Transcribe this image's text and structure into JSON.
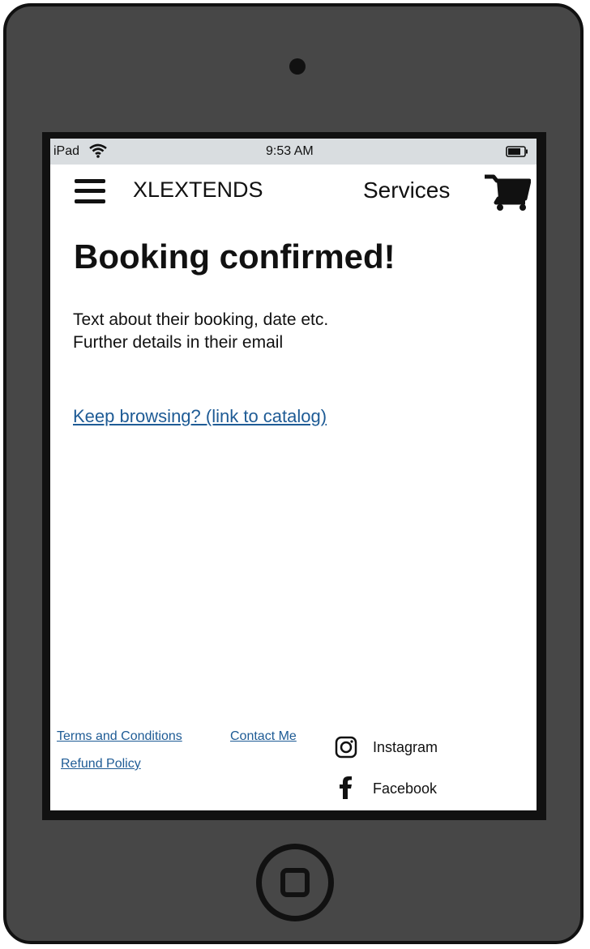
{
  "status_bar": {
    "device": "iPad",
    "time": "9:53 AM",
    "icons": [
      "wifi-icon",
      "battery-icon"
    ]
  },
  "header": {
    "menu_icon": "hamburger-menu-icon",
    "brand": "XLEXTENDS",
    "services": "Services",
    "cart_icon": "shopping-cart-icon"
  },
  "main": {
    "title": "Booking confirmed!",
    "text_line1": "Text about their booking, date etc.",
    "text_line2": "Further details in their email",
    "keep_browsing": "Keep browsing? (link to catalog)"
  },
  "footer": {
    "terms": "Terms and Conditions",
    "contact": "Contact Me",
    "refund": "Refund Policy",
    "instagram": "Instagram",
    "facebook": "Facebook"
  },
  "colors": {
    "device_body": "#474747",
    "status_bar": "#d9dde0",
    "link": "#1e5b95"
  }
}
